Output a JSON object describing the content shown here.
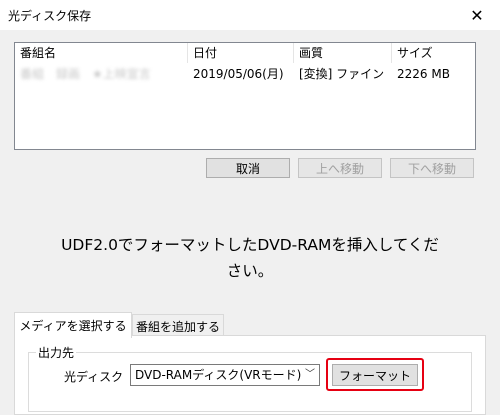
{
  "window": {
    "title": "光ディスク保存",
    "close_glyph": "✕"
  },
  "list": {
    "columns": [
      "番組名",
      "日付",
      "画質",
      "サイズ"
    ],
    "rows": [
      {
        "name": "番組　録画　★上映宣言",
        "date": "2019/05/06(月)",
        "quality": "[変換] ファイン",
        "size": "2226 MB"
      }
    ]
  },
  "buttons": {
    "cancel": "取消",
    "move_up": "上へ移動",
    "move_down": "下へ移動",
    "format": "フォーマット"
  },
  "message": {
    "line1": "UDF2.0でフォーマットしたDVD-RAMを挿入してくだ",
    "line2": "さい。"
  },
  "tabs": {
    "select_media": "メディアを選択する",
    "add_program": "番組を追加する"
  },
  "output": {
    "group_label": "出力先",
    "field_label": "光ディスク",
    "selected": "DVD-RAMディスク(VRモード)",
    "arrow_glyph": "﹀"
  },
  "colors": {
    "highlight": "#e60012"
  }
}
